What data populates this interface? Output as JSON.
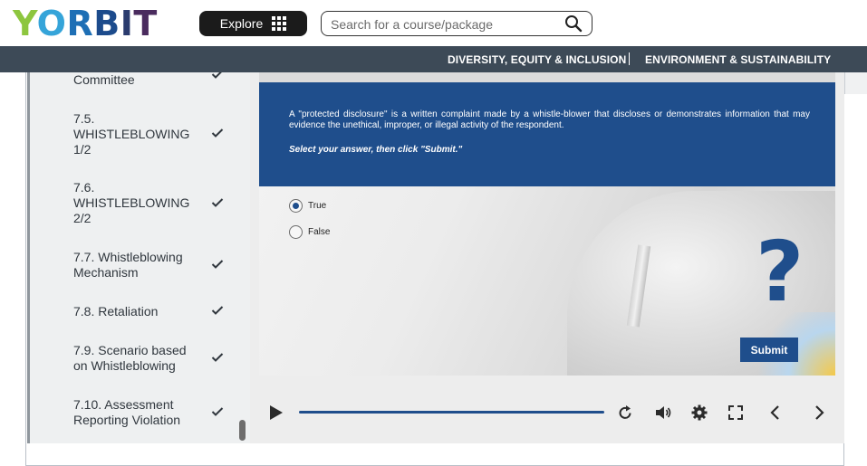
{
  "header": {
    "logo_letters": [
      "Y",
      "O",
      "R",
      "B",
      "I",
      "T"
    ],
    "explore_label": "Explore",
    "search_placeholder": "Search for a course/package"
  },
  "nav": {
    "links": [
      "DIVERSITY, EQUITY & INCLUSION",
      "ENVIRONMENT & SUSTAINABILITY"
    ]
  },
  "sidebar": {
    "items": [
      {
        "label": "Committee",
        "completed": true
      },
      {
        "label": "7.5. WHISTLEBLOWING 1/2",
        "completed": true
      },
      {
        "label": "7.6. WHISTLEBLOWING 2/2",
        "completed": true
      },
      {
        "label": "7.7. Whistleblowing Mechanism",
        "completed": true
      },
      {
        "label": "7.8. Retaliation",
        "completed": true
      },
      {
        "label": "7.9. Scenario based on Whistleblowing",
        "completed": true
      },
      {
        "label": "7.10. Assessment Reporting Violation",
        "completed": true
      }
    ]
  },
  "slide": {
    "question": "A \"protected disclosure\" is a written complaint made by a whistle-blower that discloses or demonstrates information that may evidence the unethical, improper, or illegal activity of the respondent.",
    "instruction": "Select your answer, then click \"Submit.\"",
    "options": [
      {
        "label": "True",
        "selected": true
      },
      {
        "label": "False",
        "selected": false
      }
    ],
    "question_mark": "?",
    "submit_label": "Submit"
  },
  "player": {
    "controls": [
      "play-icon",
      "replay-icon",
      "volume-icon",
      "settings-icon",
      "fullscreen-icon",
      "previous-icon",
      "next-icon"
    ],
    "progress": 1.0
  },
  "colors": {
    "accent": "#1f4e8c",
    "navbar": "#3d4a57",
    "sidebar_bg": "#eef0f1"
  }
}
